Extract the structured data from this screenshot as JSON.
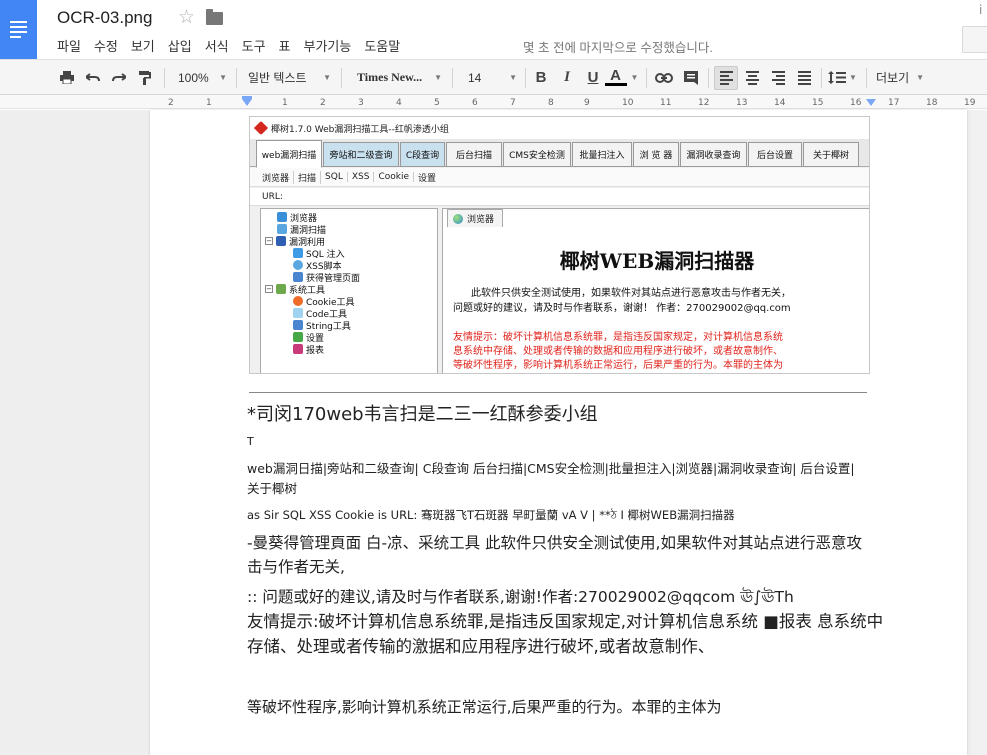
{
  "app": {
    "doc_title": "OCR-03.png",
    "menu": [
      "파일",
      "수정",
      "보기",
      "삽입",
      "서식",
      "도구",
      "표",
      "부가기능",
      "도움말"
    ],
    "last_edit": "몇 초 전에 마지막으로 수정했습니다.",
    "right_letter": "i"
  },
  "toolbar": {
    "zoom": "100%",
    "style": "일반 텍스트",
    "font": "Times New...",
    "size": "14",
    "bold": "B",
    "italic": "I",
    "underline": "U",
    "text_color": "A",
    "more": "더보기",
    "text_color_value": "#000000"
  },
  "ruler": {
    "ticks": [
      "2",
      "1",
      "1",
      "2",
      "3",
      "4",
      "5",
      "6",
      "7",
      "8",
      "9",
      "10",
      "11",
      "12",
      "13",
      "14",
      "15",
      "16",
      "17",
      "18",
      "19"
    ]
  },
  "screenshot": {
    "title": "椰树1.7.0   Web漏洞扫描工具--红帆渗透小组",
    "tabs": [
      "web漏洞扫描",
      "旁站和二级查询",
      "C段查询",
      "后台扫描",
      "CMS安全检测",
      "批量扫注入",
      "浏 览 器",
      "漏洞收录查询",
      "后台设置",
      "关于椰树"
    ],
    "subtabs": [
      "浏览器",
      "扫描",
      "SQL",
      "XSS",
      "Cookie",
      "设置"
    ],
    "url_label": "URL:",
    "tree": [
      {
        "label": "浏览器",
        "color": "#3a8fd9",
        "pm": ""
      },
      {
        "label": "漏洞扫描",
        "color": "#5aa6e0",
        "pm": ""
      },
      {
        "label": "漏洞利用",
        "color": "#2f5fb3",
        "pm": "−"
      },
      {
        "label": "SQL 注入",
        "color": "#3f9be3",
        "pm": ""
      },
      {
        "label": "XSS脚本",
        "color": "#5aa6e0",
        "pm": ""
      },
      {
        "label": "获得管理页面",
        "color": "#4a86d0",
        "pm": ""
      },
      {
        "label": "系统工具",
        "color": "#6da84a",
        "pm": "−"
      },
      {
        "label": "Cookie工具",
        "color": "#ef6b2a",
        "pm": ""
      },
      {
        "label": "Code工具",
        "color": "#9fd3ef",
        "pm": ""
      },
      {
        "label": "String工具",
        "color": "#4a86d0",
        "pm": ""
      },
      {
        "label": "设置",
        "color": "#47a847",
        "pm": ""
      },
      {
        "label": "报表",
        "color": "#c93a7b",
        "pm": ""
      }
    ],
    "pane_tab": "浏览器",
    "heading": "椰树WEB漏洞扫描器",
    "body_1": "此软件只供安全测试使用，如果软件对其站点进行恶意攻击与作者无关，",
    "body_2": "问题或好的建议，请及时与作者联系，谢谢！ 作者：270029002@qq.com",
    "warn_1": "友情提示：破坏计算机信息系统罪，是指违反国家规定，对计算机信息系统",
    "warn_2": "息系统中存储、处理或者传输的数据和应用程序进行破坏，或者故意制作、",
    "warn_3": "等破坏性程序，影响计算机系统正常运行，后果严重的行为。本罪的主体为"
  },
  "ocr_text": {
    "line1": "*司闵170web韦言扫是二三一红酥参委小组",
    "line2": "T",
    "line3": "web漏洞日描|旁站和二级查询| C段查询 后台扫描|CMS安全检测|批量担注入|浏览器|漏洞收录查询| 后台设置|关于椰树",
    "line4": "as Sir SQL XSS Cookie is URL: 骞斑器飞T石斑器 早町量蘭 vA V | **ঠ I 椰树WEB漏洞扫描器",
    "line5": "-曼葵得管理頁面 白-凉、采统工具 此软件只供安全测试使用,如果软件对其站点进行恶意攻击与作者无关,",
    "line6": ":: 问题或好的建议,请及时与作者联系,谢谢!作者:270029002@qqcom ঊ∫ঊTh",
    "line7": "友情提示:破坏计算机信息系统罪,是指违反国家规定,对计算机信息系统 ■报表 息系统中存储、处理或者传输的激据和应用程序进行破坏,或者故意制作、",
    "line8": "等破坏性程序,影响计算机系统正常运行,后果严重的行为。本罪的主体为"
  }
}
